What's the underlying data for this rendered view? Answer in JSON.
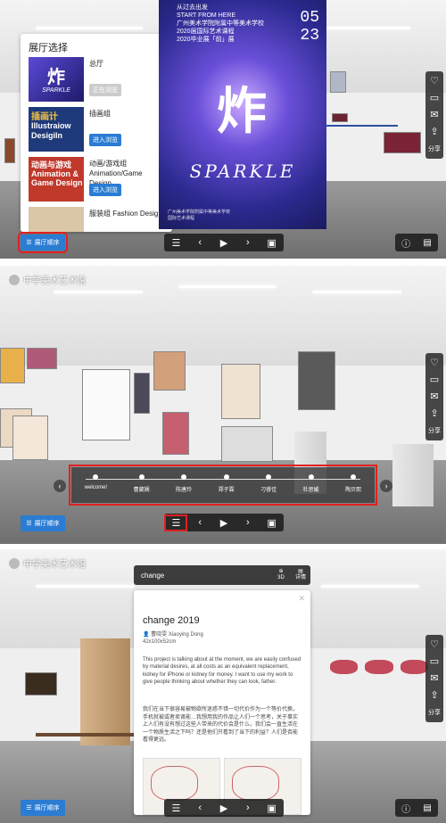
{
  "panel1": {
    "gallery_name": "",
    "dialog": {
      "title": "展厅选择",
      "items": [
        {
          "thumb_title": "炸",
          "thumb_sub": "SPARKLE",
          "thumb_bg": "#3a2fa0",
          "name": "总厅",
          "button": "正在浏览",
          "active": false
        },
        {
          "thumb_title": "插画计",
          "thumb_sub": "Illustraiow Desigiln",
          "thumb_bg": "#1f3a7a",
          "name": "插画组",
          "button": "进入浏览",
          "active": true
        },
        {
          "thumb_title": "动画与游戏",
          "thumb_sub": "Animation & Game Design",
          "thumb_bg": "#c0392b",
          "name": "动画/游戏组 Animation/Game Design",
          "button": "进入浏览",
          "active": true
        },
        {
          "thumb_title": "",
          "thumb_sub": "",
          "thumb_bg": "#d9c7a8",
          "name": "服装组 Fashion Desig",
          "button": "",
          "active": true
        }
      ]
    },
    "poster": {
      "top_text": "从过去出发\nSTART FROM HERE\n广州美术学院附属中等美术学校\n2020届国际艺术课程\n2020毕业展「前」展",
      "date": "05\n23",
      "main_char": "炸",
      "sparkle": "SPARKLE",
      "footer": "广州美术学院附属中等美术学校\n国际艺术课程"
    },
    "hall_button": "展厅顺序"
  },
  "panel2": {
    "gallery_name": "中学美术艺术馆",
    "timeline": [
      "welcome!",
      "曹葳娴",
      "陈唐玲",
      "郑子霖",
      "刁睿佳",
      "杜思媛",
      "陶贝熙"
    ],
    "hall_button": "展厅顺序"
  },
  "panel3": {
    "gallery_name": "中学美术艺术馆",
    "search_query": "change",
    "search_btn1": "3D",
    "search_btn2": "详情",
    "detail": {
      "title": "change 2019",
      "author": "曹晓雯 Xiaoying Dong",
      "size": "42x100x52cm",
      "desc_en": "This project is talking about at the moment, we are easily confused by material desires, at all costs as an equivalent replacement, kidney for iPhone or kidney for money. I want to use my work to give people thinking about whether they can look, father.",
      "desc_zh": "我们在当下很容易被物欲所迷惑不惜一切代价作为一个等价代换，手机就被或者卖肾能…我想用我的作品让人们一个思考，关于事实上人们有没有想过这些人带来的代价会是什么，我们会一直生活在一个物质生活之下吗？还是他们只看到了当下的利益？人们是否能看得更远。"
    },
    "hall_button": "展厅顺序"
  },
  "side_toolbar": {
    "share_label": "分享"
  },
  "colors": {
    "accent": "#2b7cd3",
    "highlight": "#e02020"
  }
}
